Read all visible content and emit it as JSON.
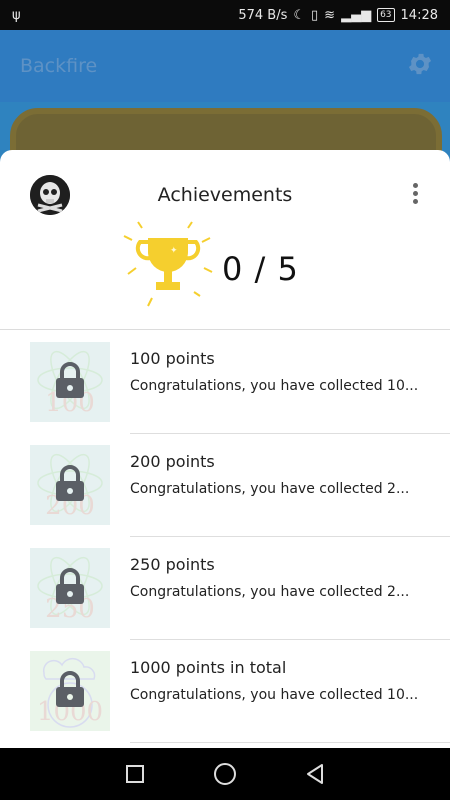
{
  "status_bar": {
    "speed": "574 B/s",
    "battery": "63",
    "time": "14:28"
  },
  "app": {
    "title": "Backfire"
  },
  "sheet": {
    "title": "Achievements",
    "progress_text": "0 / 5"
  },
  "achievements": [
    {
      "title": "100 points",
      "description": "Congratulations, you have collected 10...",
      "badge_number": "100"
    },
    {
      "title": "200 points",
      "description": "Congratulations, you have collected 2...",
      "badge_number": "200"
    },
    {
      "title": "250 points",
      "description": "Congratulations, you have collected 2...",
      "badge_number": "250"
    },
    {
      "title": "1000 points in total",
      "description": "Congratulations, you have collected 10...",
      "badge_number": "1000"
    }
  ],
  "colors": {
    "app_bar": "#2f7bc0",
    "trophy": "#f5cf2e",
    "lock": "#5b5f66"
  }
}
